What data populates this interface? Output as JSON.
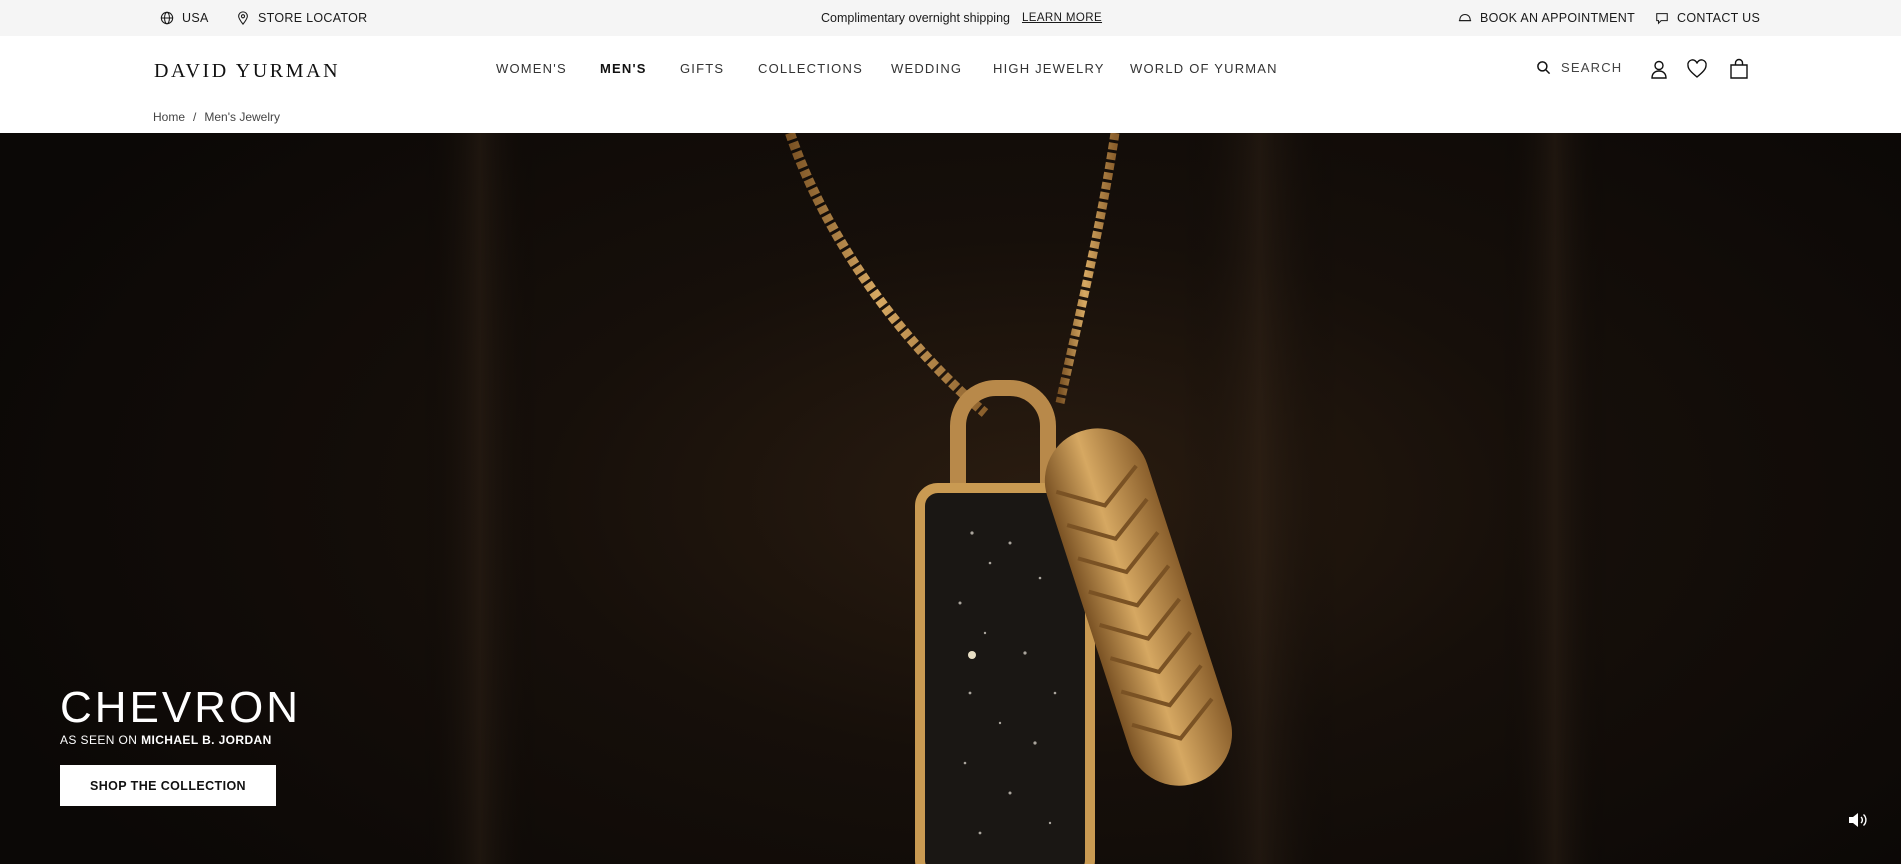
{
  "utility": {
    "country": "USA",
    "store_locator": "STORE LOCATOR",
    "promo_text": "Complimentary overnight shipping",
    "promo_link": "LEARN MORE",
    "book": "BOOK AN APPOINTMENT",
    "contact": "CONTACT US"
  },
  "header": {
    "logo": "DAVID YURMAN",
    "nav": [
      "WOMEN'S",
      "MEN'S",
      "GIFTS",
      "COLLECTIONS",
      "WEDDING",
      "HIGH JEWELRY",
      "WORLD OF YURMAN"
    ],
    "active_nav": "MEN'S",
    "search_label": "SEARCH"
  },
  "breadcrumb": {
    "home": "Home",
    "separator": "/",
    "current": "Men's Jewelry"
  },
  "hero": {
    "title": "CHEVRON",
    "subtitle_prefix": "AS SEEN ON ",
    "subtitle_name": "MICHAEL B. JORDAN",
    "cta": "SHOP THE COLLECTION"
  },
  "colors": {
    "utility_bg": "#f5f5f5",
    "hero_bg": "#140e0a",
    "gold": "#c99a52"
  },
  "icons": {
    "country": "globe-icon",
    "store": "location-pin-icon",
    "book": "cap-icon",
    "contact": "chat-icon",
    "search": "search-icon",
    "account": "user-icon",
    "wishlist": "heart-icon",
    "bag": "shopping-bag-icon",
    "sound": "speaker-icon"
  }
}
